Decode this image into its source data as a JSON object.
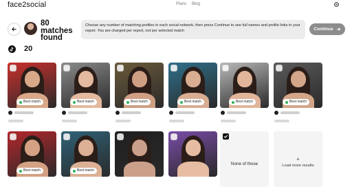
{
  "app": {
    "brand": "face2social"
  },
  "nav": {
    "plans": "Plans",
    "blog": "Blog"
  },
  "header": {
    "matches_line1": "80",
    "matches_line2": "matches",
    "matches_line3": "found",
    "notice": "Choose any number of matching profiles in each social network, then press Continue to see full names and profile links in your report. You are charged per report, not per selected match",
    "continue_label": "Continue"
  },
  "network": {
    "icon": "tiktok-icon",
    "count": "20"
  },
  "badges": {
    "best_match": "Best match"
  },
  "cards": [
    {
      "best_match": true,
      "selected": false,
      "palette": "#c9302c"
    },
    {
      "best_match": true,
      "selected": false,
      "palette": "#8a8a8a"
    },
    {
      "best_match": true,
      "selected": false,
      "palette": "#6b5a3a"
    },
    {
      "best_match": true,
      "selected": false,
      "palette": "#2f6f8a"
    },
    {
      "best_match": true,
      "selected": false,
      "palette": "#b9b9b9"
    },
    {
      "best_match": true,
      "selected": false,
      "palette": "#5a5a5a"
    },
    {
      "best_match": true,
      "selected": false,
      "palette": "#b3262b"
    },
    {
      "best_match": true,
      "selected": false,
      "palette": "#2f6277"
    },
    {
      "best_match": false,
      "selected": false,
      "palette": "#1f1f1f"
    },
    {
      "best_match": false,
      "selected": false,
      "palette": "#7a4ca8"
    }
  ],
  "special": {
    "none_label": "None of those",
    "load_more_label": "Load more results",
    "load_more_symbol": "+"
  },
  "colors": {
    "accent": "#111111",
    "continue_bg": "#8c8c8c",
    "best_dot": "#2fb45a"
  }
}
